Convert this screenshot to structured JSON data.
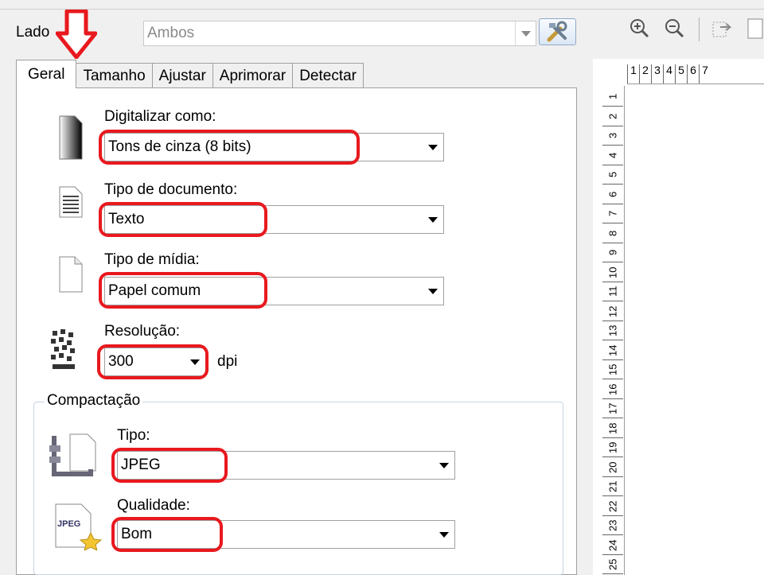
{
  "side": {
    "label": "Lado",
    "value": "Ambos"
  },
  "tabs": [
    {
      "label": "Geral",
      "active": true
    },
    {
      "label": "Tamanho",
      "active": false
    },
    {
      "label": "Ajustar",
      "active": false
    },
    {
      "label": "Aprimorar",
      "active": false
    },
    {
      "label": "Detectar",
      "active": false
    }
  ],
  "general": {
    "scan_as": {
      "label": "Digitalizar como:",
      "value": "Tons de cinza (8 bits)"
    },
    "doc_type": {
      "label": "Tipo de documento:",
      "value": "Texto"
    },
    "media_type": {
      "label": "Tipo de mídia:",
      "value": "Papel comum"
    },
    "resolution": {
      "label": "Resolução:",
      "value": "300",
      "unit": "dpi"
    }
  },
  "compression": {
    "title": "Compactação",
    "type": {
      "label": "Tipo:",
      "value": "JPEG"
    },
    "quality": {
      "label": "Qualidade:",
      "value": "Bom"
    },
    "jpeg_icon_text": "JPEG"
  },
  "ruler": {
    "horizontal": [
      "1",
      "2",
      "3",
      "4",
      "5",
      "6",
      "7"
    ],
    "vertical": [
      "1",
      "2",
      "3",
      "4",
      "5",
      "6",
      "7",
      "8",
      "9",
      "10",
      "11",
      "12",
      "13",
      "14",
      "15",
      "16",
      "17",
      "18",
      "19",
      "20",
      "21",
      "22",
      "23",
      "24",
      "25"
    ]
  },
  "colors": {
    "highlight": "#e8191e",
    "panel_bg": "#f0f0f0"
  },
  "icons": [
    "down-arrow-annotation",
    "tools-icon",
    "zoom-in-icon",
    "zoom-out-icon",
    "rotate-icon",
    "page-icon"
  ]
}
